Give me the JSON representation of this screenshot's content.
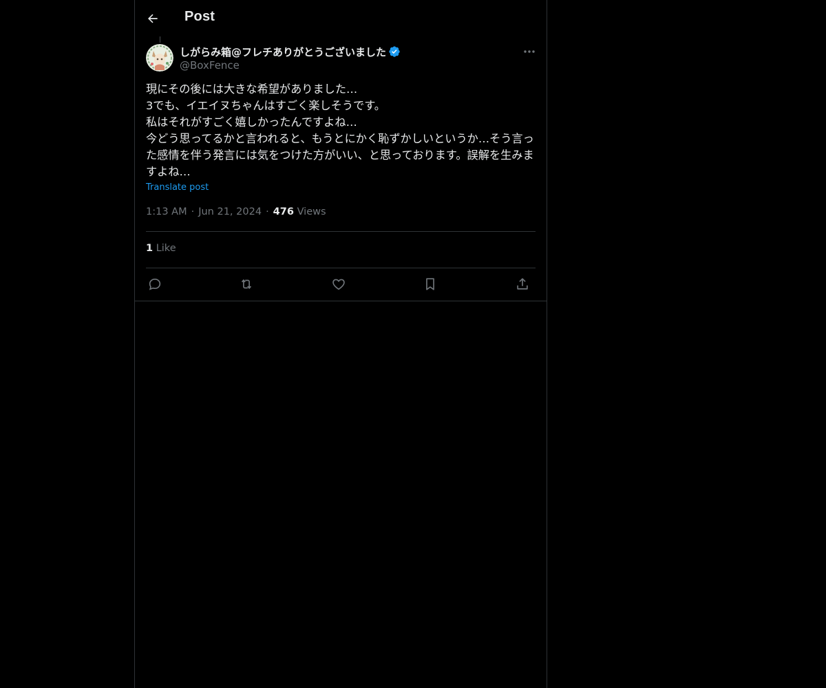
{
  "header": {
    "title": "Post",
    "back_icon": "arrow-left-icon"
  },
  "post": {
    "author": {
      "display_name": "しがらみ箱@フレチありがとうございました",
      "handle": "@BoxFence",
      "verified": true,
      "verified_color": "#1d9bf0"
    },
    "text": "現にその後には大きな希望がありました…\n3でも、イエイヌちゃんはすごく楽しそうです。\n私はそれがすごく嬉しかったんですよね…\n今どう思ってるかと言われると、もうとにかく恥ずかしいというか…そう言った感情を伴う発言には気をつけた方がいい、と思っております。誤解を生みますよね…",
    "translate_label": "Translate post",
    "time": "1:13 AM",
    "date": "Jun 21, 2024",
    "separator": "·",
    "views_count": "476",
    "views_label": "Views",
    "likes_count": "1",
    "likes_label": "Like"
  },
  "actions": [
    "reply-icon",
    "repost-icon",
    "like-icon",
    "bookmark-icon",
    "share-icon"
  ],
  "colors": {
    "background": "#000000",
    "text": "#e7e9ea",
    "muted": "#71767b",
    "accent": "#1d9bf0",
    "border": "#2f3336"
  }
}
